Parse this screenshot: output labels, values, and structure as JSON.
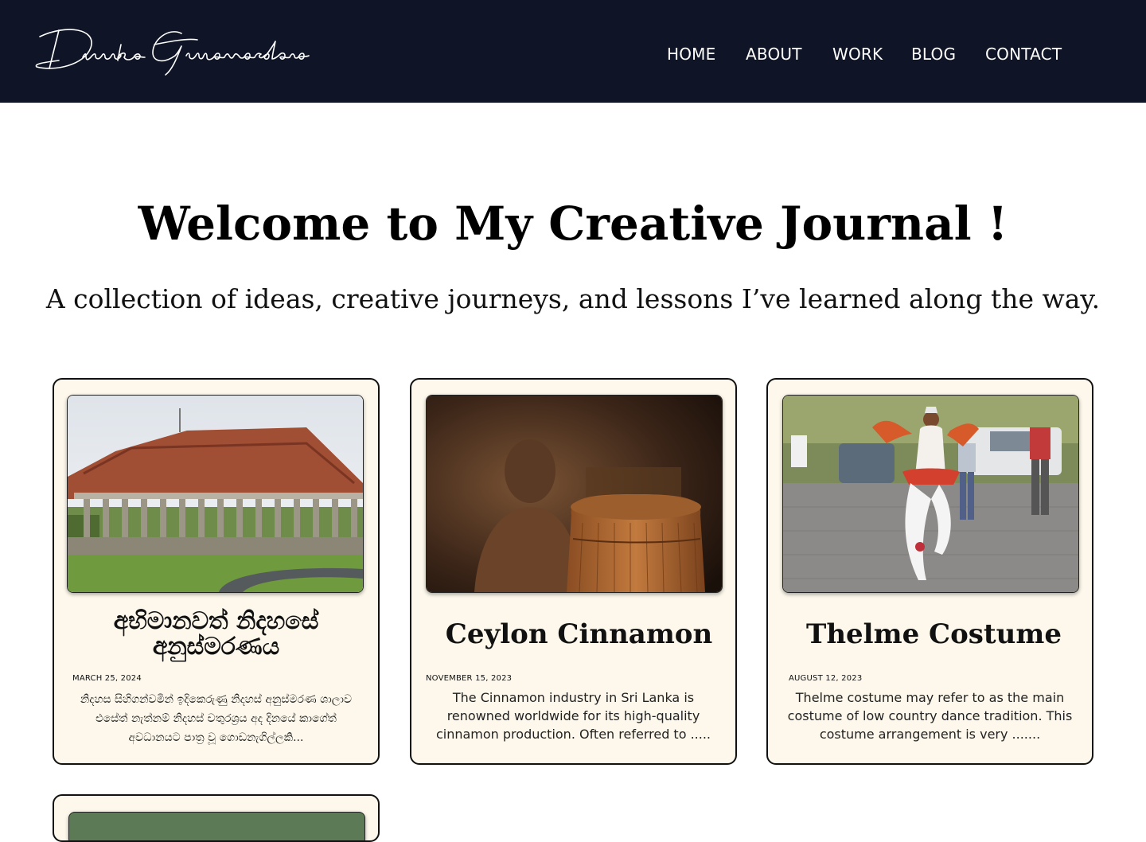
{
  "header": {
    "logo_text": "Dinuka Gunawardana",
    "nav": [
      "HOME",
      "ABOUT",
      "WORK",
      "BLOG",
      "CONTACT"
    ]
  },
  "hero": {
    "title": "Welcome to My Creative Journal !",
    "subtitle": "A collection of ideas, creative journeys, and lessons I’ve learned along the way."
  },
  "posts": [
    {
      "title": "අභිමානවත් නිදහසේ අනුස්මරණය",
      "date": "MARCH 25, 2024",
      "excerpt": "නිදහස සිහිගන්වමින් ඉදිකෙරුණු නිදහස් අනුස්මරණ ශාලාව එසේත් නැත්නම් නිදහස් චතුරශ්‍රය අද දිනයේ කාගේත් අවධානයට පාත්‍ර වූ ගොඩනැගිල්ලකි...",
      "image": "independence-memorial-hall-photo"
    },
    {
      "title": "Ceylon Cinnamon",
      "date": "NOVEMBER 15, 2023",
      "excerpt": "The Cinnamon industry in Sri Lanka is renowned worldwide for its high-quality cinnamon production. Often referred to .....",
      "image": "cinnamon-worker-photo"
    },
    {
      "title": "Thelme Costume",
      "date": "AUGUST 12, 2023",
      "excerpt": "Thelme costume may refer to as the main costume of low country dance tradition. This costume arrangement is very .......",
      "image": "kandyan-dancer-photo"
    }
  ]
}
